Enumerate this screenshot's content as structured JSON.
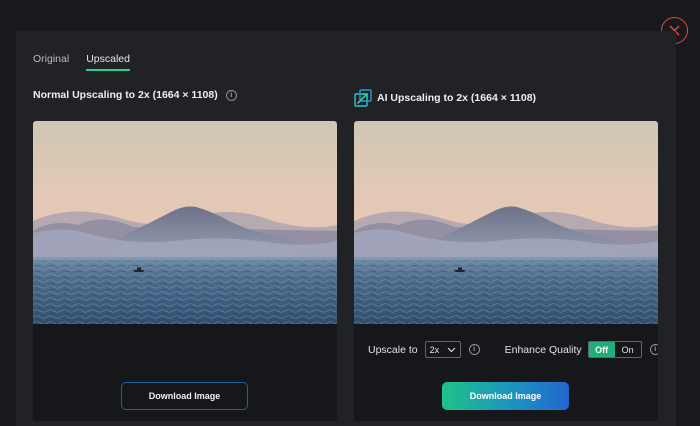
{
  "tabs": [
    {
      "label": "Original",
      "active": false
    },
    {
      "label": "Upscaled",
      "active": true
    }
  ],
  "left_panel": {
    "title": "Normal Upscaling to 2x (1664 × 1108)",
    "download_label": "Download Image"
  },
  "right_panel": {
    "title": "AI Upscaling to 2x (1664 × 1108)",
    "upscale_label": "Upscale to",
    "upscale_value": "2x",
    "enhance_label": "Enhance Quality",
    "toggle_off": "Off",
    "toggle_on": "On",
    "toggle_selected": "Off",
    "download_label": "Download Image"
  },
  "icons": {
    "close": "close-icon",
    "info": "info-icon",
    "ai": "ai-upscale-icon",
    "select": "chevron-down-icon"
  },
  "colors": {
    "accent_green": "#2fd08e",
    "close_red": "#e0464b",
    "toggle_active": "#23ad7a",
    "gradient_start": "#1ec28a",
    "gradient_end": "#2366ce",
    "outline_blue": "#1d5fa8"
  },
  "info_glyph": "i"
}
